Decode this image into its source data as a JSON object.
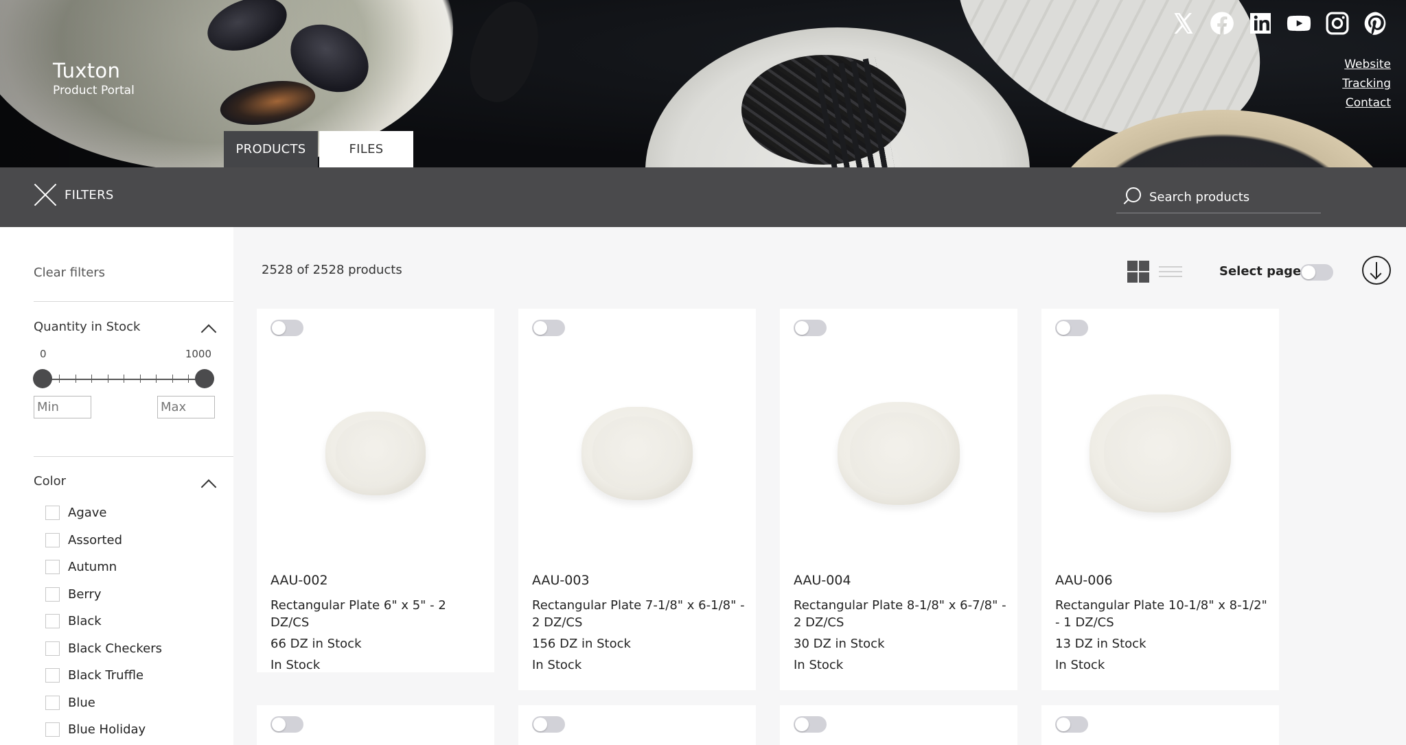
{
  "brand": {
    "name": "Tuxton",
    "subtitle": "Product Portal"
  },
  "social_icons": [
    "x-icon",
    "facebook-icon",
    "linkedin-icon",
    "youtube-icon",
    "instagram-icon",
    "pinterest-icon"
  ],
  "top_links": {
    "website": "Website",
    "tracking": "Tracking",
    "contact": "Contact"
  },
  "tabs": {
    "products": "PRODUCTS",
    "files": "FILES"
  },
  "filterbar": {
    "filters_label": "FILTERS",
    "search_placeholder": "Search products"
  },
  "sidebar": {
    "clear_filters": "Clear filters",
    "quantity": {
      "title": "Quantity in Stock",
      "min_label": "0",
      "max_label": "1000",
      "min_placeholder": "Min",
      "max_placeholder": "Max"
    },
    "color": {
      "title": "Color",
      "options": [
        "Agave",
        "Assorted",
        "Autumn",
        "Berry",
        "Black",
        "Black Checkers",
        "Black Truffle",
        "Blue",
        "Blue Holiday"
      ]
    }
  },
  "main": {
    "count": "2528 of 2528 products",
    "select_page": "Select page",
    "products": [
      {
        "sku": "AAU-002",
        "name": "Rectangular Plate 6\" x 5\" - 2 DZ/CS",
        "qty": "66 DZ in Stock",
        "status": "In Stock"
      },
      {
        "sku": "AAU-003",
        "name": "Rectangular Plate 7-1/8\" x 6-1/8\" - 2 DZ/CS",
        "qty": "156 DZ in Stock",
        "status": "In Stock"
      },
      {
        "sku": "AAU-004",
        "name": "Rectangular Plate 8-1/8\" x 6-7/8\" - 2 DZ/CS",
        "qty": "30 DZ in Stock",
        "status": "In Stock"
      },
      {
        "sku": "AAU-006",
        "name": "Rectangular Plate 10-1/8\" x 8-1/2\" - 1 DZ/CS",
        "qty": "13 DZ in Stock",
        "status": "In Stock"
      }
    ]
  },
  "colors": {
    "filterbar": "#4a4a4c",
    "active_tab": "#444548",
    "toggle_off": "#d2d2d8"
  }
}
